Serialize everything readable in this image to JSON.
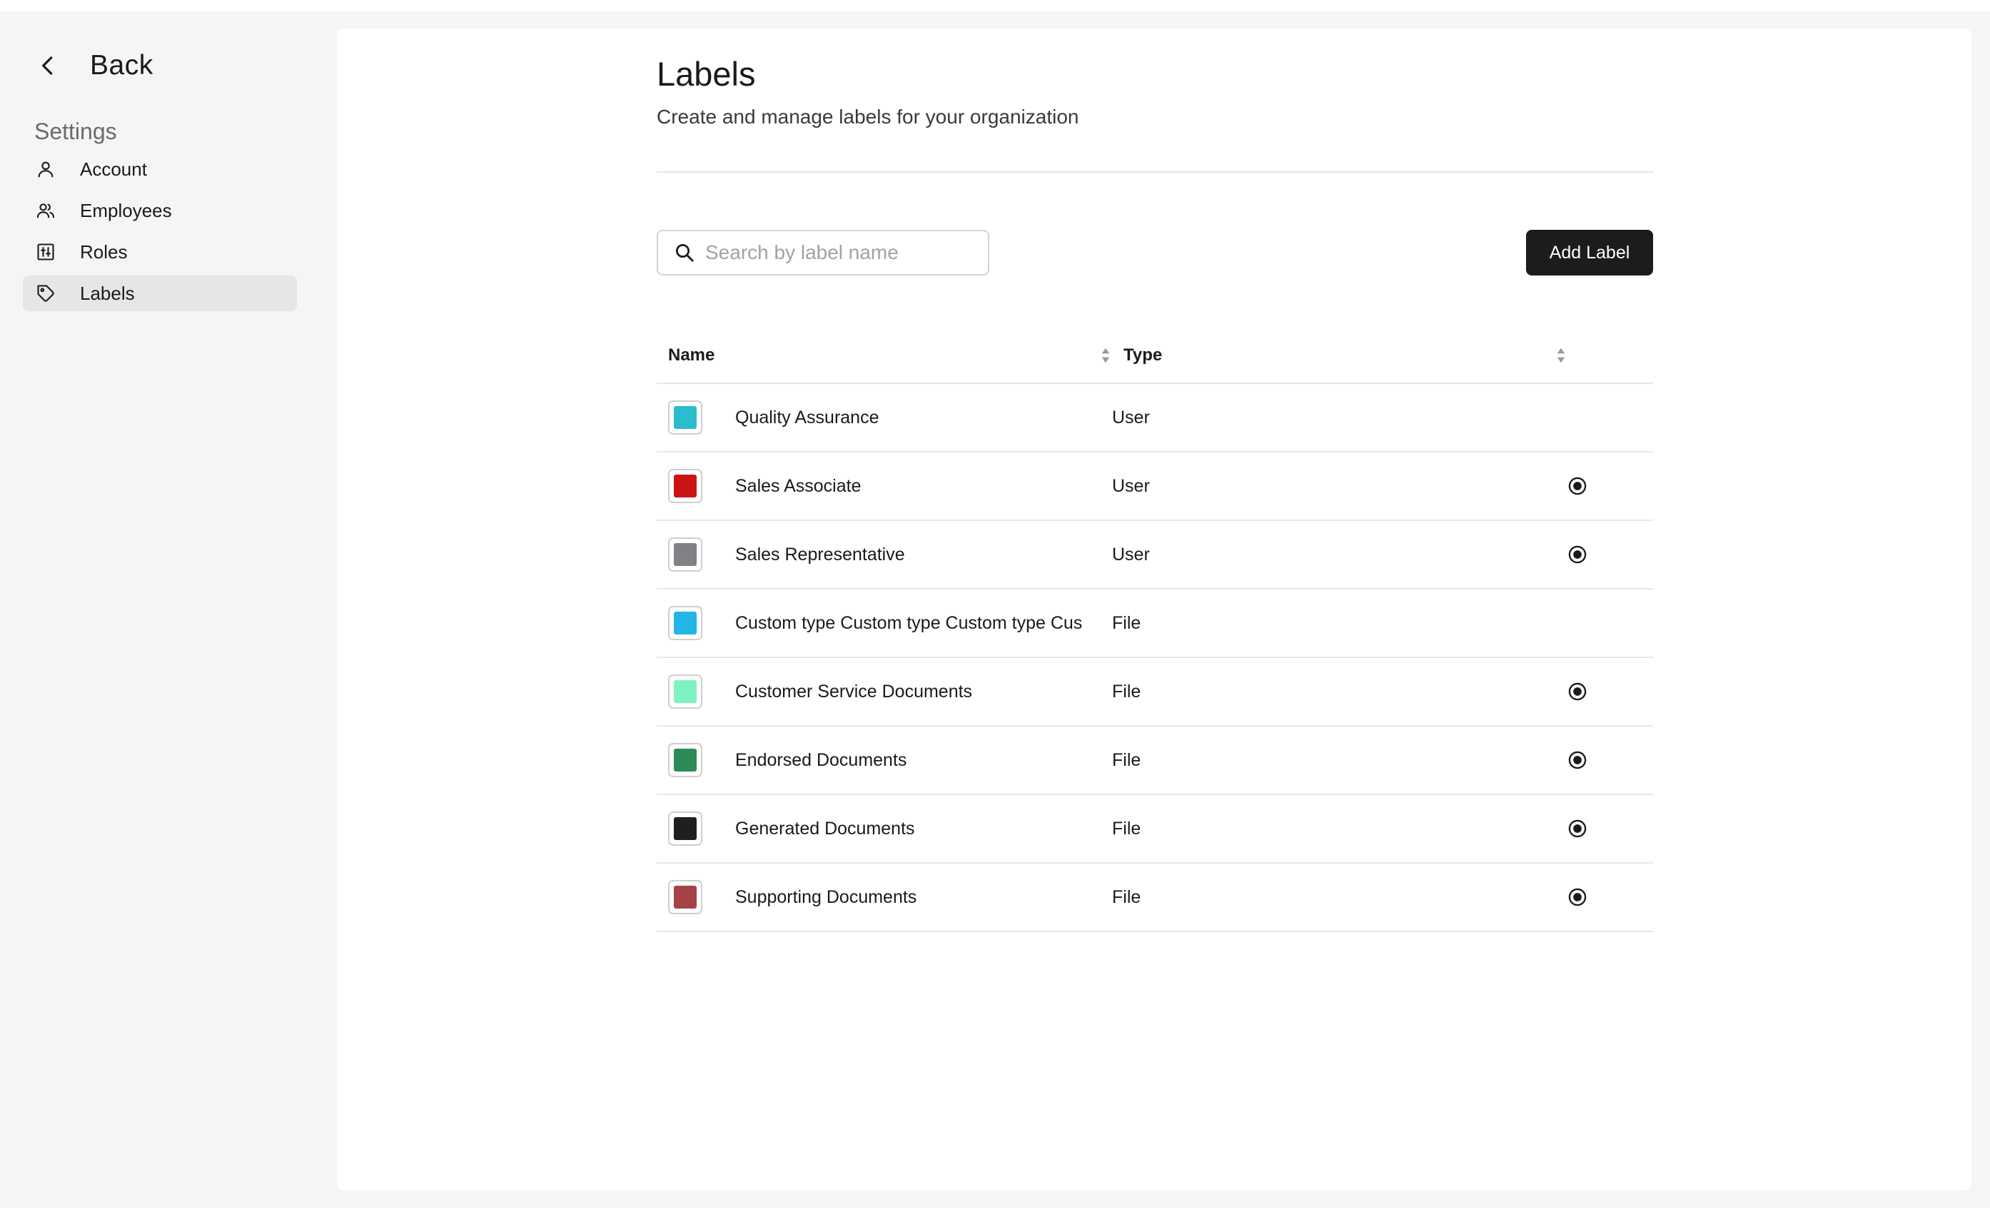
{
  "sidebar": {
    "back_label": "Back",
    "section_label": "Settings",
    "items": [
      {
        "label": "Account",
        "icon": "user-icon",
        "active": false
      },
      {
        "label": "Employees",
        "icon": "users-icon",
        "active": false
      },
      {
        "label": "Roles",
        "icon": "roles-icon",
        "active": false
      },
      {
        "label": "Labels",
        "icon": "tag-icon",
        "active": true
      }
    ]
  },
  "page": {
    "title": "Labels",
    "subtitle": "Create and manage labels for your organization"
  },
  "search": {
    "placeholder": "Search by label name",
    "value": ""
  },
  "toolbar": {
    "add_label": "Add Label"
  },
  "table": {
    "columns": [
      "Name",
      "Type"
    ],
    "rows": [
      {
        "name": "Quality Assurance",
        "type": "User",
        "color": "#2bbccf",
        "radio": false
      },
      {
        "name": "Sales Associate",
        "type": "User",
        "color": "#cc1417",
        "radio": true
      },
      {
        "name": "Sales Representative",
        "type": "User",
        "color": "#808085",
        "radio": true
      },
      {
        "name": "Custom type Custom type Custom type Cus",
        "type": "File",
        "color": "#21b6e6",
        "radio": false
      },
      {
        "name": "Customer Service Documents",
        "type": "File",
        "color": "#7ef2c2",
        "radio": true
      },
      {
        "name": "Endorsed Documents",
        "type": "File",
        "color": "#2e8a57",
        "radio": true
      },
      {
        "name": "Generated Documents",
        "type": "File",
        "color": "#1f1f1f",
        "radio": true
      },
      {
        "name": "Supporting Documents",
        "type": "File",
        "color": "#a64245",
        "radio": true
      }
    ]
  }
}
